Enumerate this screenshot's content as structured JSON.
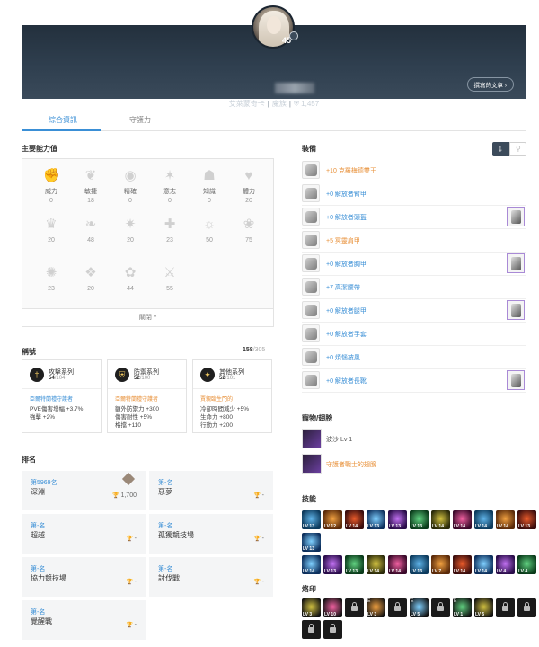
{
  "profile": {
    "level": "45",
    "server": "艾萊蒙奇卡",
    "race": "魔族",
    "power_icon": "shield-icon",
    "power": "1,457",
    "posts_button": "撰寫的文章 ›"
  },
  "tabs": [
    {
      "label": "綜合資訊"
    },
    {
      "label": "守護力"
    }
  ],
  "stats": {
    "title": "主要能力值",
    "items": [
      {
        "label": "威力",
        "value": "0",
        "icon": "fist-icon"
      },
      {
        "label": "敏捷",
        "value": "18",
        "icon": "wing-icon"
      },
      {
        "label": "精確",
        "value": "0",
        "icon": "eye-icon"
      },
      {
        "label": "意志",
        "value": "0",
        "icon": "flame-icon"
      },
      {
        "label": "知識",
        "value": "0",
        "icon": "book-icon"
      },
      {
        "label": "體力",
        "value": "20",
        "icon": "heart-icon"
      },
      {
        "label": "",
        "value": "20",
        "icon": "crown-icon"
      },
      {
        "label": "",
        "value": "48",
        "icon": "feather-icon"
      },
      {
        "label": "",
        "value": "20",
        "icon": "star-icon"
      },
      {
        "label": "",
        "value": "23",
        "icon": "cross-icon"
      },
      {
        "label": "",
        "value": "50",
        "icon": "fire-icon"
      },
      {
        "label": "",
        "value": "75",
        "icon": "leaf-icon"
      },
      {
        "label": "",
        "value": "23",
        "icon": "tree-icon"
      },
      {
        "label": "",
        "value": "20",
        "icon": "butterfly-icon"
      },
      {
        "label": "",
        "value": "44",
        "icon": "swirl-icon"
      },
      {
        "label": "",
        "value": "55",
        "icon": "sword-icon"
      }
    ],
    "collapse_label": "關閉 ^"
  },
  "titles": {
    "title": "稱號",
    "count": "158",
    "total": "/305",
    "cards": [
      {
        "name": "攻擊系列",
        "count": "54",
        "total": "/104",
        "headline": "亞爾特蘭禮守護者",
        "lines": [
          "PVE傷害增幅 +3.7%",
          "強擊 +2%"
        ],
        "color": "blue"
      },
      {
        "name": "防禦系列",
        "count": "52",
        "total": "/100",
        "headline": "亞爾特蘭禮守護者",
        "lines": [
          "額外防禦力 +300",
          "傷害耐性 +5%",
          "格擋 +110"
        ],
        "color": "orange"
      },
      {
        "name": "其他系列",
        "count": "52",
        "total": "/101",
        "headline": "賈親臨生門的",
        "lines": [
          "冷卻時間減少 +5%",
          "生命力 +800",
          "行動力 +200"
        ],
        "color": "orange"
      }
    ]
  },
  "ranking": {
    "title": "排名",
    "items": [
      {
        "rank": "第5969名",
        "name": "深淵",
        "score": "1,700"
      },
      {
        "rank": "第-名",
        "name": "惡夢",
        "score": "-"
      },
      {
        "rank": "第-名",
        "name": "超越",
        "score": "-"
      },
      {
        "rank": "第-名",
        "name": "孤獨競技場",
        "score": "-"
      },
      {
        "rank": "第-名",
        "name": "協力競技場",
        "score": "-"
      },
      {
        "rank": "第-名",
        "name": "討伐戰",
        "score": "-"
      },
      {
        "rank": "第-名",
        "name": "覺醒戰",
        "score": "-"
      }
    ]
  },
  "equipment": {
    "title": "裝備",
    "items": [
      {
        "name": "+10 克羅梅德雙王",
        "color": "orange",
        "skin": false
      },
      {
        "name": "+0 解放者臂甲",
        "color": "blue",
        "skin": false
      },
      {
        "name": "+0 解放者頭盔",
        "color": "blue",
        "skin": true
      },
      {
        "name": "+5 冥靈肩甲",
        "color": "orange",
        "skin": false
      },
      {
        "name": "+0 解放者胸甲",
        "color": "blue",
        "skin": true
      },
      {
        "name": "+7 高潔腰帶",
        "color": "blue",
        "skin": false
      },
      {
        "name": "+0 解放者腿甲",
        "color": "blue",
        "skin": true
      },
      {
        "name": "+0 解放者手套",
        "color": "blue",
        "skin": false
      },
      {
        "name": "+0 煩惱披風",
        "color": "blue",
        "skin": false
      },
      {
        "name": "+0 解放者長靴",
        "color": "blue",
        "skin": true
      }
    ]
  },
  "pets": {
    "title": "寵物/翅膀",
    "items": [
      {
        "name": "波沙 Lv 1",
        "color": "gray"
      },
      {
        "name": "守護者戰士的翅膀",
        "color": "orange"
      }
    ]
  },
  "skills": {
    "title": "技能",
    "row1": [
      "13",
      "12",
      "14",
      "13",
      "13",
      "13",
      "14",
      "14",
      "14",
      "14",
      "13"
    ],
    "row1b": [
      "13"
    ],
    "row2": [
      "14",
      "13",
      "13",
      "14",
      "14",
      "13",
      "7",
      "14",
      "14",
      "4",
      "4",
      "5"
    ]
  },
  "runes": {
    "title": "烙印",
    "row1": [
      {
        "tag": "",
        "lv": "3",
        "locked": false
      },
      {
        "tag": "",
        "lv": "10",
        "locked": false
      },
      {
        "tag": "",
        "lv": "",
        "locked": true
      },
      {
        "tag": "E",
        "lv": "3",
        "locked": false
      },
      {
        "tag": "",
        "lv": "",
        "locked": true
      },
      {
        "tag": "E",
        "lv": "5",
        "locked": false
      },
      {
        "tag": "",
        "lv": "",
        "locked": true
      },
      {
        "tag": "E",
        "lv": "1",
        "locked": false
      },
      {
        "tag": "",
        "lv": "5",
        "locked": false
      },
      {
        "tag": "",
        "lv": "",
        "locked": true
      },
      {
        "tag": "",
        "lv": "",
        "locked": true
      }
    ],
    "row2": [
      {
        "tag": "",
        "lv": "",
        "locked": true
      },
      {
        "tag": "",
        "lv": "",
        "locked": true
      }
    ]
  }
}
